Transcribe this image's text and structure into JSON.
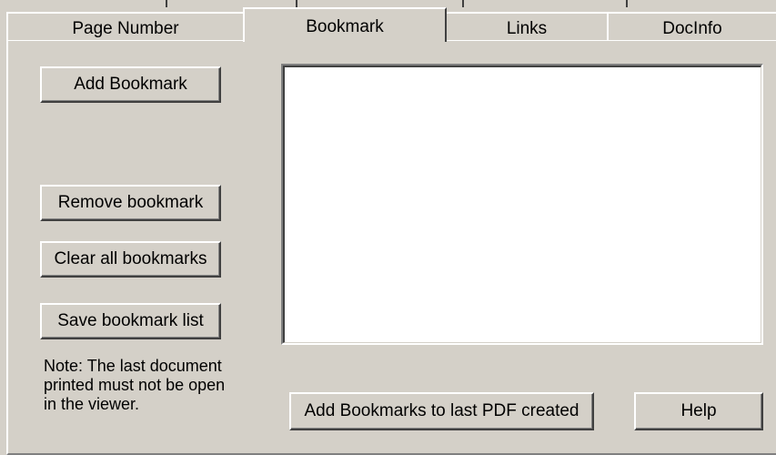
{
  "tabs": [
    {
      "label": "Page Number",
      "selected": false
    },
    {
      "label": "Bookmark",
      "selected": true
    },
    {
      "label": "Links",
      "selected": false
    },
    {
      "label": "DocInfo",
      "selected": false
    }
  ],
  "buttons": {
    "add_bookmark": "Add Bookmark",
    "remove_bookmark": "Remove bookmark",
    "clear_all": "Clear all bookmarks",
    "save_list": "Save bookmark list",
    "add_to_last_pdf": "Add Bookmarks to last PDF created",
    "help": "Help"
  },
  "bookmark_list": {
    "items": []
  },
  "note": "Note: The last document\nprinted must not be open\nin the viewer."
}
